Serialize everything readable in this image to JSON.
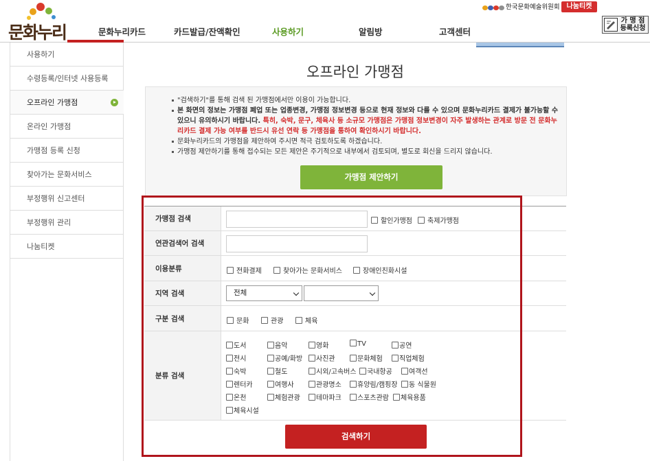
{
  "header": {
    "logo_text": "문화누리",
    "gnb": [
      "문화누리카드",
      "카드발급/잔액확인",
      "사용하기",
      "알림방",
      "고객센터"
    ],
    "active_gnb": "사용하기",
    "arts_council": "한국문화예술위원회",
    "ticket_logo": "나눔티켓",
    "shop_register": [
      "가 맹 점",
      "등록신청"
    ]
  },
  "sidebar": {
    "items": [
      "사용하기",
      "수령등록/인터넷 사용등록",
      "오프라인 가맹점",
      "온라인 가맹점",
      "가맹점 등록 신청",
      "찾아가는 문화서비스",
      "부정행위 신고센터",
      "부정행위 관리",
      "나눔티켓"
    ],
    "active": "오프라인 가맹점"
  },
  "main": {
    "title": "오프라인 가맹점",
    "notice": {
      "line1": "\"검색하기\"를 통해 검색 된 가맹점에서만 이용이 가능합니다.",
      "line2_bold": "본 화면의 정보는 가맹점 폐업 또는 업종변경, 가맹점 정보변경 등으로 현재 정보와 다를 수 있으며 문화누리카드 결제가 불가능할 수 있으니 유의하시기 바랍니다.",
      "line2_red": " 특히, 숙박, 문구, 체육사 등 소규모 가맹점은 가맹점 정보변경이 자주 발생하는 관계로 방문 전 문화누리카드 결제 가능 여부를 반드시 유선 연락 등 가맹점을 통하여 확인하시기 바랍니다.",
      "line3": "문화누리카드의 가맹점을 제안하여 주시면 적극 검토하도록 하겠습니다.",
      "line4": "가맹점 제안하기를 통해 접수되는 모든 제안은 주기적으로 내부에서 검토되며, 별도로 회신을 드리지 않습니다."
    },
    "proposal_button": "가맹점 제안하기",
    "search": {
      "shop_search_label": "가맹점 검색",
      "shop_search_value": "",
      "discount_label": "할인가맹점",
      "festival_label": "축제가맹점",
      "keyword_label": "연관검색어 검색",
      "keyword_value": "",
      "usage_label": "이용분류",
      "usage_options": [
        "전화결제",
        "찾아가는 문화서비스",
        "장애인친화시설"
      ],
      "region_label": "지역 검색",
      "region_selected": "전체",
      "region_sub_selected": "",
      "type_label": "구분 검색",
      "type_options": [
        "문화",
        "관광",
        "체육"
      ],
      "category_label": "분류 검색",
      "categories": [
        [
          "도서",
          "음악",
          "영화",
          "TV",
          "공연"
        ],
        [
          "전시",
          "공예/화방",
          "사진관",
          "문화체험",
          "직업체험"
        ],
        [
          "숙박",
          "철도",
          "시외/고속버스",
          "국내항공",
          "여객선"
        ],
        [
          "렌터카",
          "여행사",
          "관광명소",
          "휴양림/캠핑장",
          "동 식물원"
        ],
        [
          "온천",
          "체험관광",
          "테마파크",
          "스포츠관람",
          "체육용품"
        ],
        [
          "체육시설"
        ]
      ],
      "search_button": "검색하기"
    }
  },
  "colors": {
    "accent_green": "#7fb43a",
    "accent_red": "#c42121",
    "highlight": "#b0141b"
  }
}
